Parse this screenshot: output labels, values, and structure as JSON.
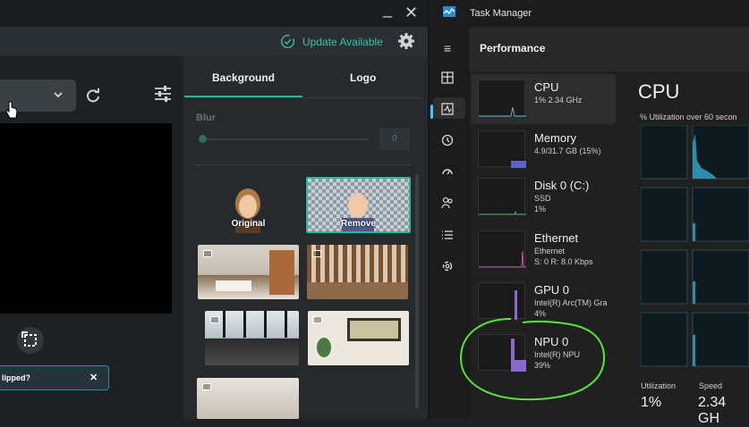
{
  "app": {
    "update_label": "Update Available",
    "tabs": [
      "Background",
      "Logo"
    ],
    "blur_label": "Blur",
    "blur_value": "0",
    "thumbnails": [
      {
        "label": "Original"
      },
      {
        "label": "Remove"
      }
    ],
    "toast_text": "lipped?",
    "toast_close": "✕",
    "window_minimize": "_",
    "window_close": "✕",
    "accent_color": "#2fb39c"
  },
  "task_manager": {
    "title": "Task Manager",
    "section": "Performance",
    "items": [
      {
        "name": "CPU",
        "line1": "1% 2.34 GHz",
        "line2": ""
      },
      {
        "name": "Memory",
        "line1": "4.9/31.7 GB (15%)",
        "line2": ""
      },
      {
        "name": "Disk 0 (C:)",
        "line1": "SSD",
        "line2": "1%"
      },
      {
        "name": "Ethernet",
        "line1": "Ethernet",
        "line2": "S: 0 R: 8.0 Kbps"
      },
      {
        "name": "GPU 0",
        "line1": "Intel(R) Arc(TM) Gra",
        "line2": "4%"
      },
      {
        "name": "NPU 0",
        "line1": "Intel(R) NPU",
        "line2": "39%"
      }
    ],
    "detail_title": "CPU",
    "detail_subtitle": "% Utilization over 60 secon",
    "stats": [
      {
        "label": "Utilization",
        "value": "1%"
      },
      {
        "label": "Speed",
        "value": "2.34 GH"
      }
    ],
    "nav_icons": [
      "hamburger-icon",
      "processes-icon",
      "performance-icon",
      "app-history-icon",
      "startup-icon",
      "users-icon",
      "details-icon",
      "services-icon"
    ],
    "annotation_color": "#55e83a"
  }
}
